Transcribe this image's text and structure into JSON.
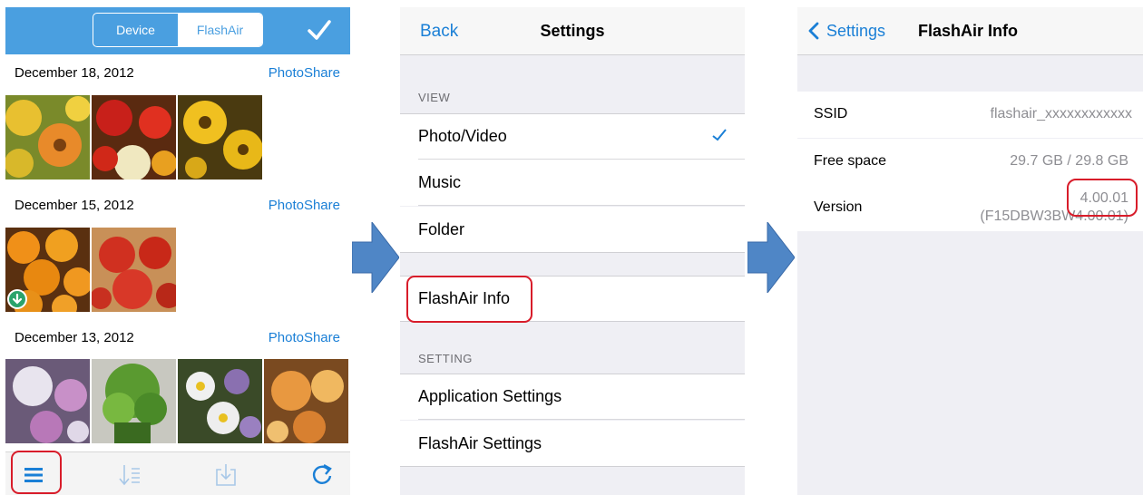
{
  "screen1": {
    "segment": {
      "device_label": "Device",
      "flashair_label": "FlashAir",
      "selected": "FlashAir"
    },
    "accent_color": "#4a9fe0",
    "groups": [
      {
        "date": "December 18, 2012",
        "action": "PhotoShare"
      },
      {
        "date": "December 15, 2012",
        "action": "PhotoShare"
      },
      {
        "date": "December 13, 2012",
        "action": "PhotoShare"
      }
    ],
    "toolbar_icons": [
      "menu-icon",
      "sort-icon",
      "download-icon",
      "refresh-icon"
    ]
  },
  "screen2": {
    "nav": {
      "back_label": "Back",
      "title": "Settings"
    },
    "view_header": "VIEW",
    "view_items": [
      "Photo/Video",
      "Music",
      "Folder"
    ],
    "selected_view": "Photo/Video",
    "info_item": "FlashAir Info",
    "setting_header": "SETTING",
    "setting_items": [
      "Application Settings",
      "FlashAir Settings"
    ]
  },
  "screen3": {
    "nav": {
      "back_label": "Settings",
      "title": "FlashAir Info"
    },
    "rows": [
      {
        "key": "SSID",
        "value": "flashair_xxxxxxxxxxxx"
      },
      {
        "key": "Free space",
        "value": "29.7 GB / 29.8 GB"
      },
      {
        "key": "Version",
        "value": "4.00.01",
        "value2": "(F15DBW3BW4.00.01)"
      }
    ]
  },
  "highlight_color": "#d81c2a",
  "arrow_color": "#4f86c6"
}
